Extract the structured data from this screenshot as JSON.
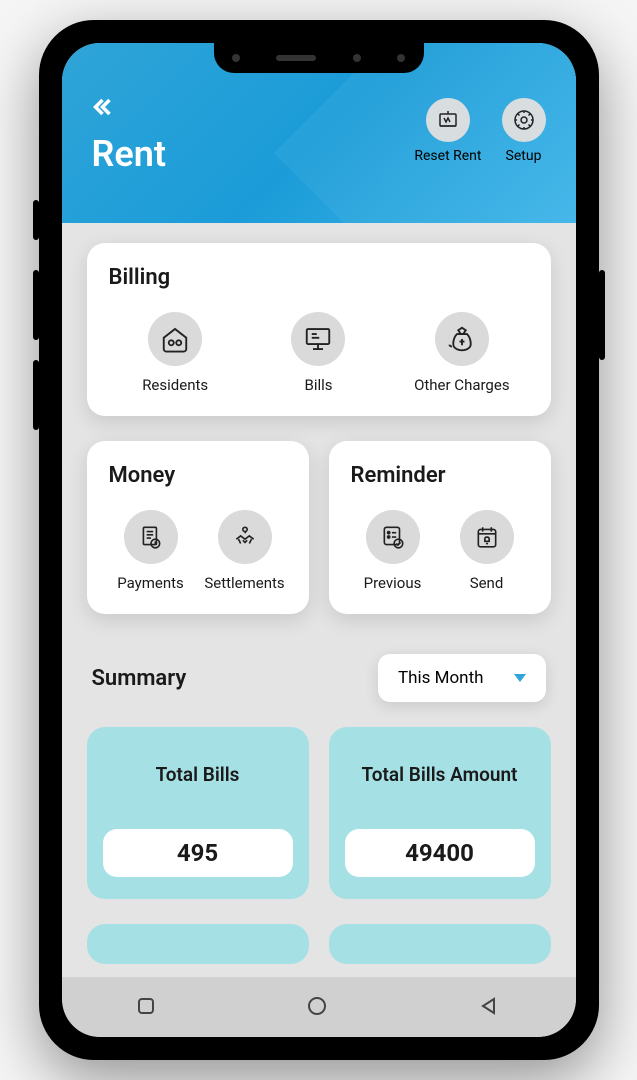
{
  "header": {
    "title": "Rent",
    "actions": {
      "reset": "Reset Rent",
      "setup": "Setup"
    }
  },
  "billing": {
    "title": "Billing",
    "items": {
      "residents": "Residents",
      "bills": "Bills",
      "other_charges": "Other Charges"
    }
  },
  "money": {
    "title": "Money",
    "items": {
      "payments": "Payments",
      "settlements": "Settlements"
    }
  },
  "reminder": {
    "title": "Reminder",
    "items": {
      "previous": "Previous",
      "send": "Send"
    }
  },
  "summary": {
    "title": "Summary",
    "dropdown": "This Month",
    "stats": {
      "total_bills": {
        "label": "Total Bills",
        "value": "495"
      },
      "total_bills_amount": {
        "label": "Total Bills Amount",
        "value": "49400"
      }
    }
  }
}
